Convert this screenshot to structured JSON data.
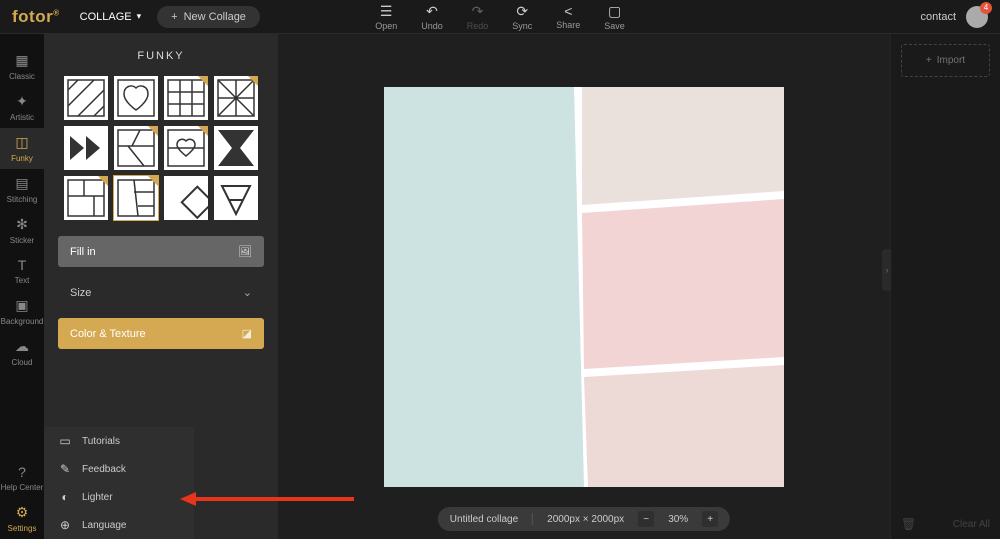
{
  "logo": "fotor",
  "mode": "COLLAGE",
  "new_collage": "New Collage",
  "top_actions": {
    "open": "Open",
    "undo": "Undo",
    "redo": "Redo",
    "sync": "Sync",
    "share": "Share",
    "save": "Save"
  },
  "contact": "contact",
  "badge_count": "4",
  "rail": {
    "classic": "Classic",
    "artistic": "Artistic",
    "funky": "Funky",
    "stitching": "Stitching",
    "sticker": "Sticker",
    "text": "Text",
    "background": "Background",
    "cloud": "Cloud",
    "help": "Help Center",
    "settings": "Settings"
  },
  "panel": {
    "title": "FUNKY",
    "fill": "Fill in",
    "size": "Size",
    "color": "Color & Texture"
  },
  "settings_menu": {
    "tutorials": "Tutorials",
    "feedback": "Feedback",
    "lighter": "Lighter",
    "language": "Language"
  },
  "import": "Import",
  "bottom": {
    "title": "Untitled collage",
    "dims": "2000px × 2000px",
    "zoom": "30%"
  },
  "clear_all": "Clear All"
}
